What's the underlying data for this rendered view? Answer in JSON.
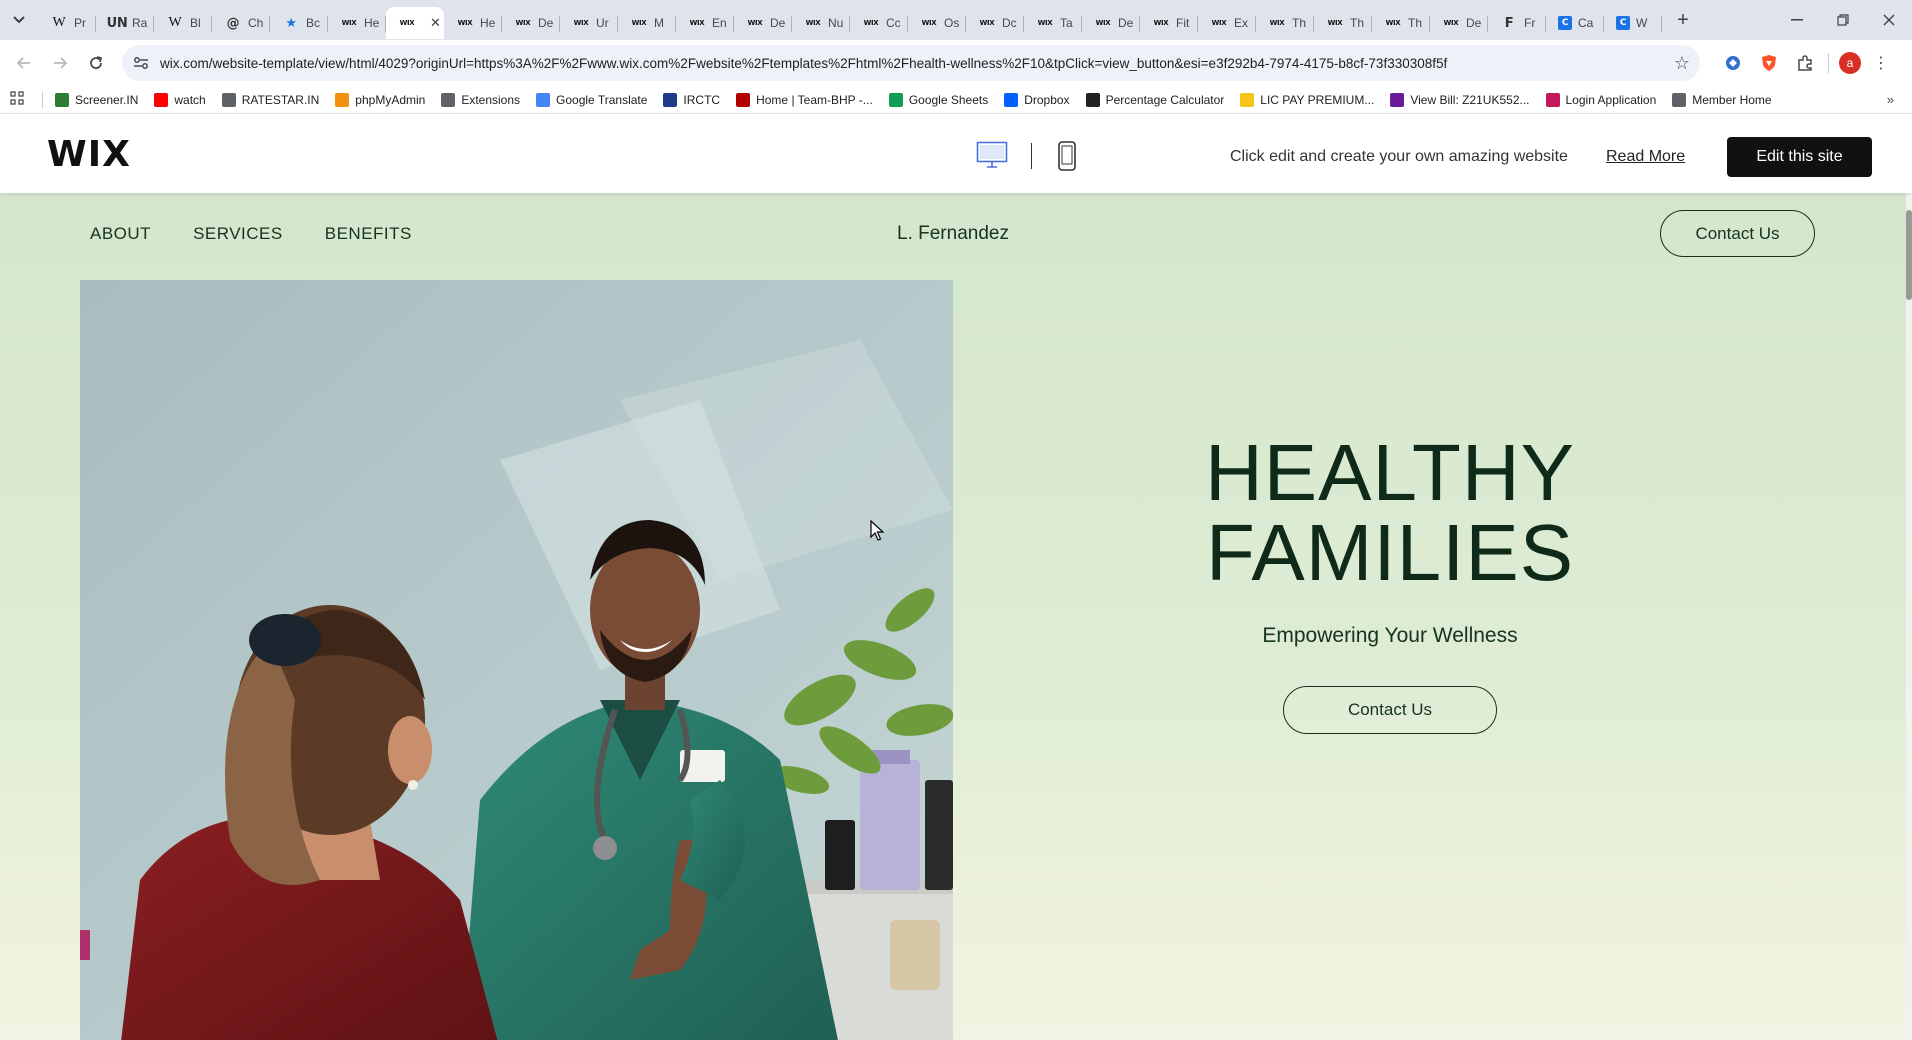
{
  "browser": {
    "tabs": [
      {
        "icon": "W",
        "title": "Pr"
      },
      {
        "icon": "UN",
        "title": "Ra"
      },
      {
        "icon": "W",
        "title": "Bl"
      },
      {
        "icon": "@",
        "title": "Ch"
      },
      {
        "icon": "★",
        "title": "Bc"
      },
      {
        "icon": "WIX",
        "title": "He"
      },
      {
        "icon": "WIX",
        "title": "",
        "active": true
      },
      {
        "icon": "WIX",
        "title": "He"
      },
      {
        "icon": "WIX",
        "title": "De"
      },
      {
        "icon": "WIX",
        "title": "Ur"
      },
      {
        "icon": "WIX",
        "title": "M"
      },
      {
        "icon": "WIX",
        "title": "En"
      },
      {
        "icon": "WIX",
        "title": "De"
      },
      {
        "icon": "WIX",
        "title": "Nu"
      },
      {
        "icon": "WIX",
        "title": "Cc"
      },
      {
        "icon": "WIX",
        "title": "Os"
      },
      {
        "icon": "WIX",
        "title": "Dc"
      },
      {
        "icon": "WIX",
        "title": "Ta"
      },
      {
        "icon": "WIX",
        "title": "De"
      },
      {
        "icon": "WIX",
        "title": "Fit"
      },
      {
        "icon": "WIX",
        "title": "Ex"
      },
      {
        "icon": "WIX",
        "title": "Th"
      },
      {
        "icon": "WIX",
        "title": "Th"
      },
      {
        "icon": "WIX",
        "title": "Th"
      },
      {
        "icon": "WIX",
        "title": "De"
      },
      {
        "icon": "F",
        "title": "Fr"
      },
      {
        "icon": "C",
        "title": "Ca"
      },
      {
        "icon": "C",
        "title": "W"
      }
    ],
    "url": "wix.com/website-template/view/html/4029?originUrl=https%3A%2F%2Fwww.wix.com%2Fwebsite%2Ftemplates%2Fhtml%2Fhealth-wellness%2F10&tpClick=view_button&esi=e3f292b4-7974-4175-b8cf-73f330308f5f",
    "profile_initial": "a",
    "bookmarks": [
      {
        "label": "Screener.IN",
        "icon": "chart-icon",
        "color": "#2e7d32"
      },
      {
        "label": "watch",
        "icon": "youtube-icon",
        "color": "#ff0000"
      },
      {
        "label": "RATESTAR.IN",
        "icon": "star-icon",
        "color": "#5f6368"
      },
      {
        "label": "phpMyAdmin",
        "icon": "phpmyadmin-icon",
        "color": "#f29111"
      },
      {
        "label": "Extensions",
        "icon": "puzzle-icon",
        "color": "#5f6368"
      },
      {
        "label": "Google Translate",
        "icon": "translate-icon",
        "color": "#4285f4"
      },
      {
        "label": "IRCTC",
        "icon": "irctc-icon",
        "color": "#1f3c88"
      },
      {
        "label": "Home | Team-BHP -...",
        "icon": "teambhp-icon",
        "color": "#b00000"
      },
      {
        "label": "Google Sheets",
        "icon": "sheets-icon",
        "color": "#0f9d58"
      },
      {
        "label": "Dropbox",
        "icon": "dropbox-icon",
        "color": "#0061fe"
      },
      {
        "label": "Percentage Calculator",
        "icon": "calculator-icon",
        "color": "#222222"
      },
      {
        "label": "LIC PAY PREMIUM...",
        "icon": "lic-icon",
        "color": "#f5c518"
      },
      {
        "label": "View Bill: Z21UK552...",
        "icon": "bill-icon",
        "color": "#6a1b9a"
      },
      {
        "label": "Login Application",
        "icon": "login-icon",
        "color": "#c2185b"
      },
      {
        "label": "Member Home",
        "icon": "member-icon",
        "color": "#5f6368"
      }
    ]
  },
  "wix_banner": {
    "logo": "WIX",
    "tagline": "Click edit and create your own amazing website",
    "read_more": "Read More",
    "edit_button": "Edit this site"
  },
  "site": {
    "nav": [
      "ABOUT",
      "SERVICES",
      "BENEFITS"
    ],
    "brand": "L. Fernandez",
    "nav_contact": "Contact Us",
    "hero_title_line1": "HEALTHY",
    "hero_title_line2": "FAMILIES",
    "hero_subtitle": "Empowering Your Wellness",
    "hero_contact": "Contact Us"
  },
  "colors": {
    "site_bg": "#d4e7cd",
    "text_dark_green": "#16331f",
    "wix_button": "#111111"
  }
}
